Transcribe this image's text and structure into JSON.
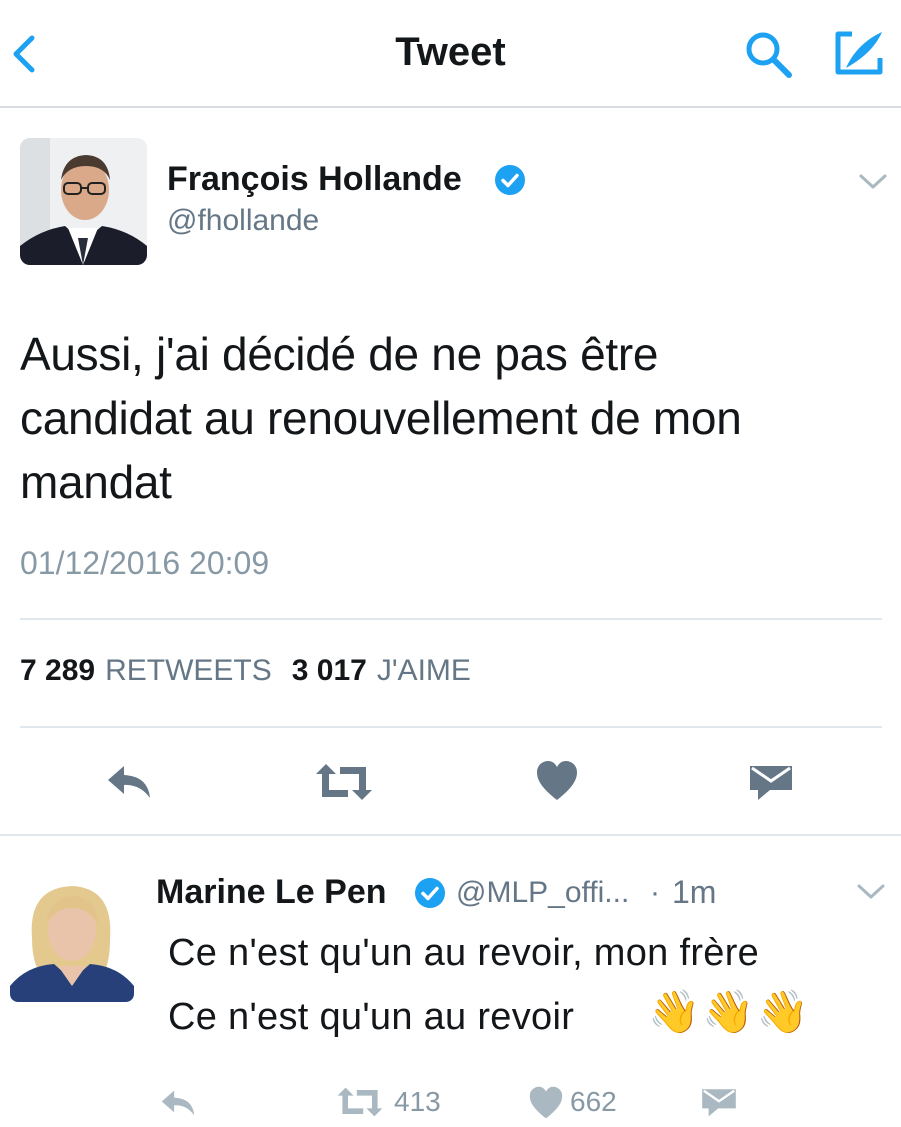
{
  "header": {
    "title": "Tweet"
  },
  "icons": {
    "back": "chevron-left-icon",
    "search": "search-icon",
    "compose": "compose-icon",
    "verified": "verified-badge-icon",
    "dropdown": "chevron-down-icon",
    "reply": "reply-icon",
    "retweet": "retweet-icon",
    "like": "heart-icon",
    "message": "envelope-icon"
  },
  "colors": {
    "accent": "#1da1f2",
    "icon_gray": "#657786",
    "muted": "#8899a6"
  },
  "main_tweet": {
    "author_name": "François Hollande",
    "author_handle": "@fhollande",
    "text_lines": [
      "Aussi, j'ai décidé de ne pas être",
      "candidat au renouvellement de mon",
      "mandat"
    ],
    "timestamp": "01/12/2016 20:09",
    "retweet_count": "7 289",
    "retweet_label": "RETWEETS",
    "like_count": "3 017",
    "like_label": "J'AIME"
  },
  "reply_tweet": {
    "author_name": "Marine Le Pen",
    "author_handle": "@MLP_offi...",
    "separator": "·",
    "time": "1m",
    "text_line_1": "Ce n'est qu'un au revoir, mon frère",
    "text_line_2": "Ce n'est qu'un au revoir",
    "emoji": "👋👋👋",
    "retweet_count": "413",
    "like_count": "662"
  }
}
